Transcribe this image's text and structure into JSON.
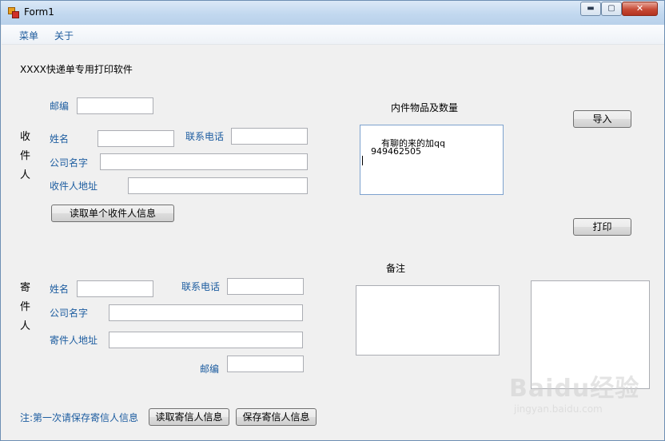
{
  "window": {
    "title": "Form1",
    "minimize": "▬",
    "maximize": "▢",
    "close": "✕"
  },
  "menu": {
    "items": [
      "菜单",
      "关于"
    ]
  },
  "app_heading": "XXXX快递单专用打印软件",
  "recipient": {
    "side_label": [
      "收",
      "件",
      "人"
    ],
    "postcode_label": "邮编",
    "name_label": "姓名",
    "phone_label": "联系电话",
    "company_label": "公司名字",
    "address_label": "收件人地址",
    "postcode_value": "",
    "name_value": "",
    "phone_value": "",
    "company_value": "",
    "address_value": "",
    "read_button": "读取单个收件人信息"
  },
  "sender": {
    "side_label": [
      "寄",
      "件",
      "人"
    ],
    "name_label": "姓名",
    "phone_label": "联系电话",
    "company_label": "公司名字",
    "address_label": "寄件人地址",
    "postcode_label": "邮编",
    "name_value": "",
    "phone_value": "",
    "company_value": "",
    "address_value": "",
    "postcode_value": ""
  },
  "contents": {
    "label": "内件物品及数量",
    "lines": [
      "有聊的来的加qq",
      "949462505"
    ]
  },
  "remarks": {
    "label": "备注",
    "value": ""
  },
  "buttons": {
    "import": "导入",
    "print": "打印",
    "read_sender": "读取寄信人信息",
    "save_sender": "保存寄信人信息"
  },
  "note": "注:第一次请保存寄信人信息",
  "watermark": {
    "logo": "Baidu经验",
    "url": "jingyan.baidu.com"
  }
}
